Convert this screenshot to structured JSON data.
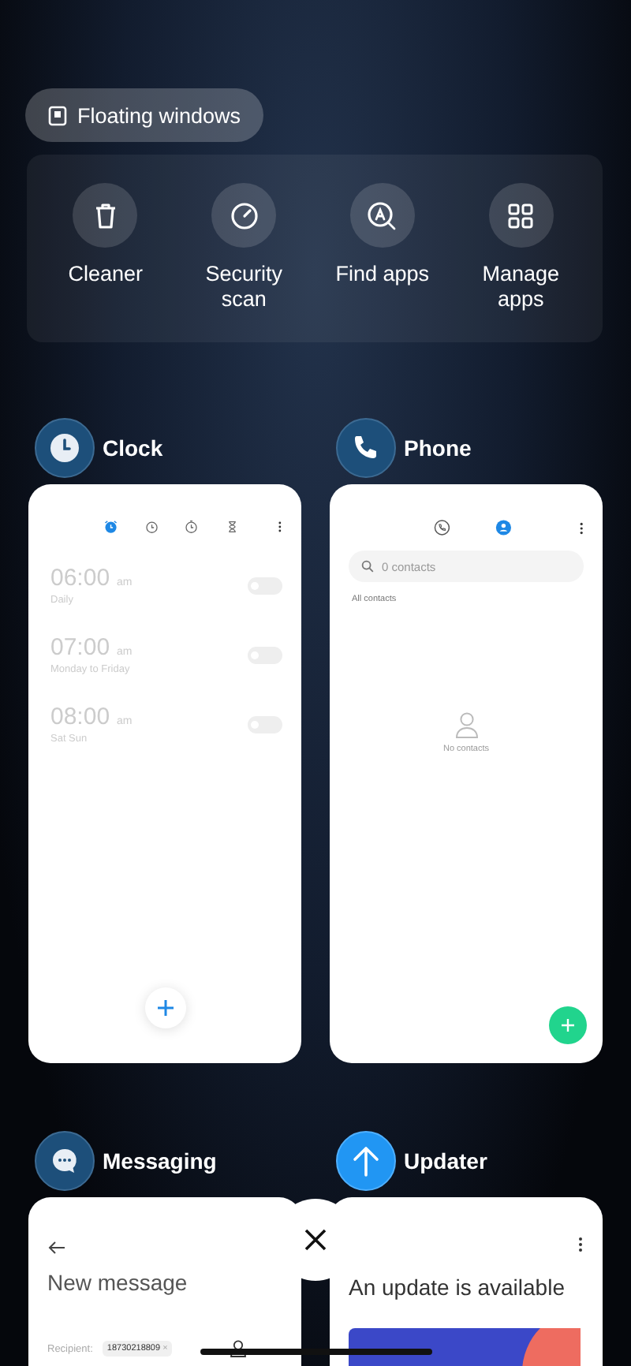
{
  "floating_windows": {
    "label": "Floating windows"
  },
  "tools": [
    {
      "kind": "trash",
      "label": "Cleaner"
    },
    {
      "kind": "gauge",
      "label": "Security scan"
    },
    {
      "kind": "search-app",
      "label": "Find apps"
    },
    {
      "kind": "grid",
      "label": "Manage apps"
    }
  ],
  "recent_apps": [
    {
      "kind": "clock",
      "name": "Clock",
      "tabs": [
        {
          "kind": "alarm",
          "selected": true
        },
        {
          "kind": "clock",
          "selected": false
        },
        {
          "kind": "stopwatch",
          "selected": false
        },
        {
          "kind": "timer",
          "selected": false
        }
      ],
      "alarms": [
        {
          "time": "06:00",
          "period": "am",
          "repeat": "Daily",
          "on": false
        },
        {
          "time": "07:00",
          "period": "am",
          "repeat": "Monday to Friday",
          "on": false
        },
        {
          "time": "08:00",
          "period": "am",
          "repeat": "Sat Sun",
          "on": false
        }
      ]
    },
    {
      "kind": "phone",
      "name": "Phone",
      "tabs": [
        {
          "kind": "recents",
          "selected": false
        },
        {
          "kind": "contacts",
          "selected": true
        }
      ],
      "search": {
        "placeholder": "0 contacts"
      },
      "section": "All contacts",
      "empty": "No contacts"
    },
    {
      "kind": "messaging",
      "name": "Messaging",
      "title": "New message",
      "recipient_label": "Recipient:",
      "recipient": "18730218809",
      "remove": "×"
    },
    {
      "kind": "updater",
      "name": "Updater",
      "title": "An update is available"
    }
  ]
}
